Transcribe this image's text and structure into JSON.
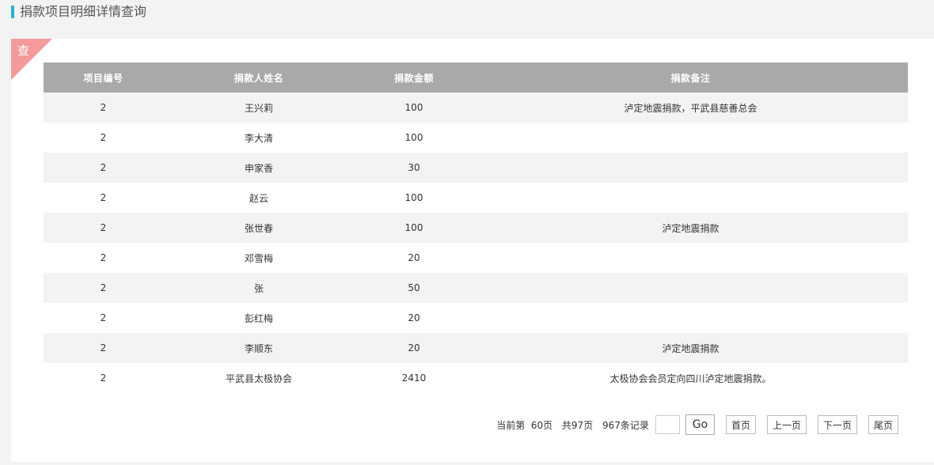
{
  "header": {
    "title": "捐款项目明细详情查询"
  },
  "panel": {
    "corner_label": "查"
  },
  "table": {
    "columns": [
      "项目编号",
      "捐款人姓名",
      "捐款金额",
      "捐款备注"
    ],
    "rows": [
      [
        "2",
        "王兴莉",
        "100",
        "泸定地震捐款，平武县慈善总会"
      ],
      [
        "2",
        "李大清",
        "100",
        ""
      ],
      [
        "2",
        "申家香",
        "30",
        ""
      ],
      [
        "2",
        "赵云",
        "100",
        ""
      ],
      [
        "2",
        "张世春",
        "100",
        "泸定地震捐款"
      ],
      [
        "2",
        "邓雪梅",
        "20",
        ""
      ],
      [
        "2",
        "张",
        "50",
        ""
      ],
      [
        "2",
        "彭红梅",
        "20",
        ""
      ],
      [
        "2",
        "李顺东",
        "20",
        "泸定地震捐款"
      ],
      [
        "2",
        "平武县太极协会",
        "2410",
        "太极协会会员定向四川泸定地震捐款。"
      ]
    ]
  },
  "pager": {
    "current_page": "当前第  60页",
    "total_pages": "共97页",
    "total_records": "967条记录",
    "goto_value": "",
    "go_label": "Go",
    "first_label": "首页",
    "prev_label": "上一页",
    "next_label": "下一页",
    "last_label": "尾页"
  },
  "colors": {
    "accent": "#1fb5d4",
    "corner": "#f59a9a",
    "header_bg": "#a9a9a9",
    "row_alt": "#f3f3f3"
  }
}
